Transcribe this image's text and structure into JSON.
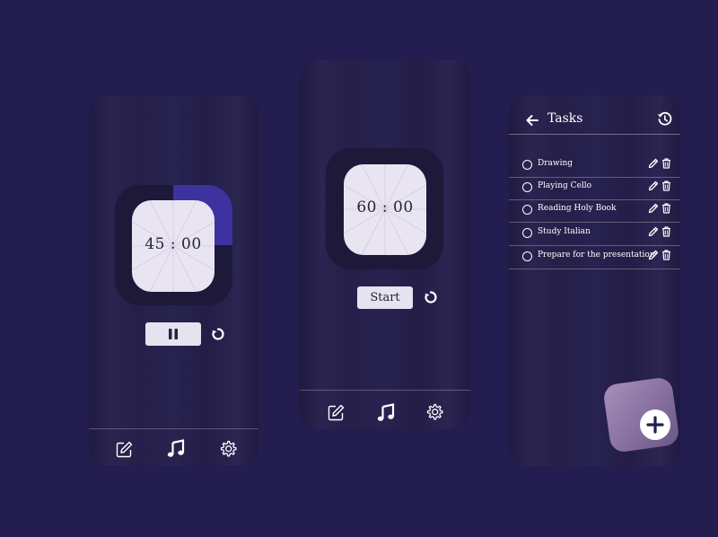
{
  "screen1": {
    "timer": "45 : 00",
    "control": "pause",
    "progress_fraction": 0.25,
    "accent": "#3e32a0"
  },
  "screen2": {
    "timer": "60 : 00",
    "start_label": "Start"
  },
  "screen3": {
    "title": "Tasks",
    "tasks": [
      {
        "label": "Drawing"
      },
      {
        "label": "Playing Cello"
      },
      {
        "label": "Reading Holy Book"
      },
      {
        "label": "Study Italian"
      },
      {
        "label": "Prepare for the presentation"
      }
    ]
  },
  "nav": {
    "items": [
      "edit-icon",
      "music-note-icon",
      "gear-icon"
    ],
    "active": "music-note-icon"
  },
  "icons": {
    "reset": "reset-icon",
    "back": "back-arrow-icon",
    "history": "history-icon",
    "add": "plus-icon"
  },
  "colors": {
    "background": "#241e50",
    "face": "#e9e4f2",
    "fab": "#8a73a3"
  }
}
